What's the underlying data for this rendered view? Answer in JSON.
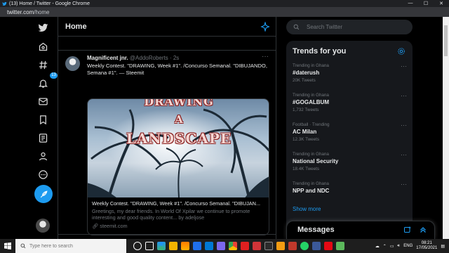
{
  "browser": {
    "window_title": "(13) Home / Twitter - Google Chrome",
    "url_host": "twitter.com",
    "url_path": "/home"
  },
  "nav": {
    "notifications_badge": "13"
  },
  "timeline": {
    "title": "Home",
    "tweet": {
      "name": "Magnificent jnr.",
      "handle_time": "@AddoRoberts · 2s",
      "more": "···",
      "text": "Weekly Contest. \"DRAWING, Week #1\". /Concurso Semanal. \"DIBUJANDO, Semana #1\". — Steemit",
      "image_text": [
        "DRAWING",
        "A",
        "LANDSCAPE"
      ],
      "card_title": "Weekly Contest. \"DRAWING, Week #1\". /Concurso Semanal. \"DIBUJAN...",
      "card_desc": "Greetings, my dear friends. In World Of Xpilar we continue to promote interesting and good quality content... by adeljose",
      "card_link": "steemit.com"
    }
  },
  "sidebar": {
    "search_placeholder": "Search Twitter",
    "trends_title": "Trends for you",
    "trends": [
      {
        "context": "Trending in Ghana",
        "name": "#daterush",
        "count": "20K Tweets"
      },
      {
        "context": "Trending in Ghana",
        "name": "#GOGALBUM",
        "count": "1,732 Tweets"
      },
      {
        "context": "Football · Trending",
        "name": "AC Milan",
        "count": "12.3K Tweets"
      },
      {
        "context": "Trending in Ghana",
        "name": "National Security",
        "count": "18.4K Tweets"
      },
      {
        "context": "Trending in Ghana",
        "name": "NPP and NDC",
        "count": ""
      }
    ],
    "show_more": "Show more",
    "messages_title": "Messages"
  },
  "taskbar": {
    "search_placeholder": "Type here to search",
    "language": "ENG",
    "time": "08:21",
    "date": "17/05/2021"
  },
  "colors": {
    "accent": "#1d9bf0",
    "background": "#000000",
    "panel": "#16181c"
  }
}
